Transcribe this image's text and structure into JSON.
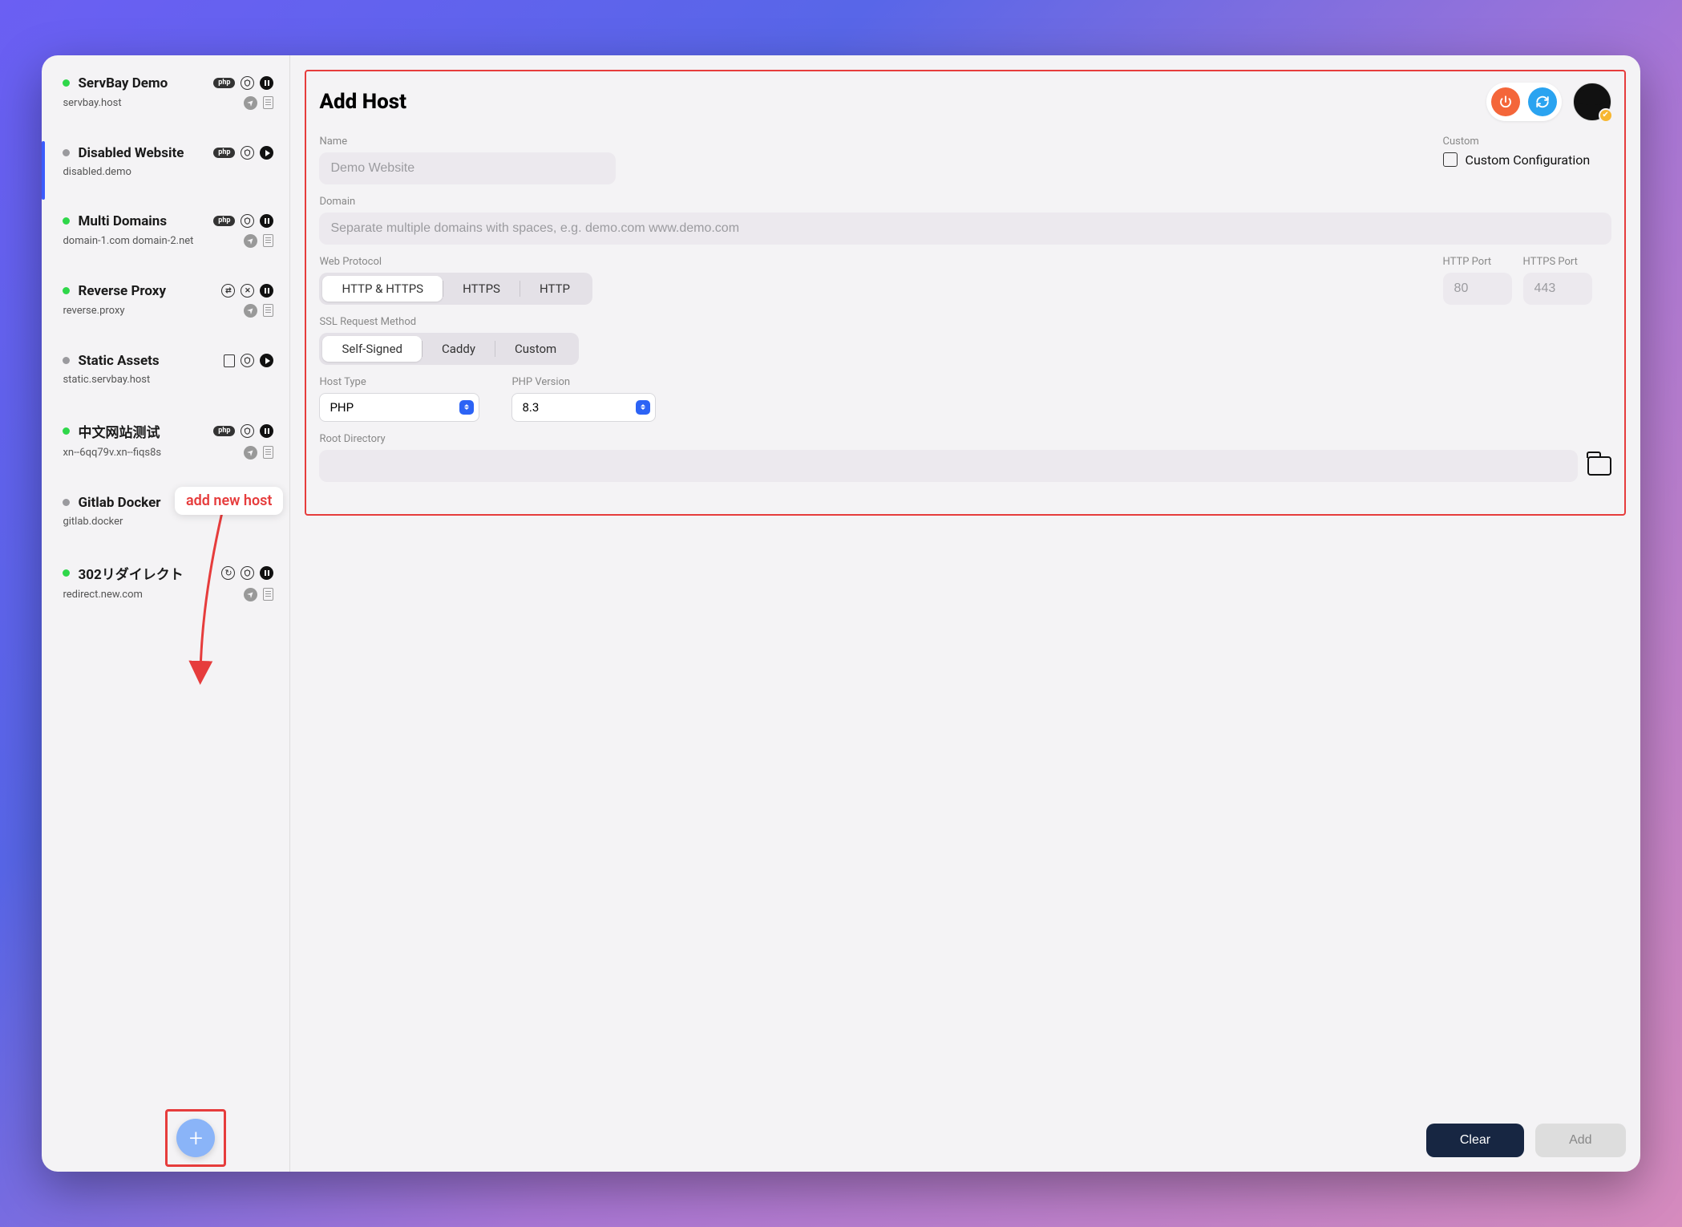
{
  "sidebar": {
    "hosts": [
      {
        "name": "ServBay Demo",
        "domain": "servbay.host",
        "status": "green",
        "tag": "php",
        "icons": [
          "shield",
          "pause"
        ],
        "sub_icons": [
          "compass",
          "doc"
        ]
      },
      {
        "name": "Disabled Website",
        "domain": "disabled.demo",
        "status": "gray",
        "tag": "php",
        "icons": [
          "shield",
          "play"
        ],
        "sub_icons": [],
        "selected": true
      },
      {
        "name": "Multi Domains",
        "domain": "domain-1.com domain-2.net",
        "status": "green",
        "tag": "php",
        "icons": [
          "shield",
          "pause"
        ],
        "sub_icons": [
          "compass",
          "doc"
        ]
      },
      {
        "name": "Reverse Proxy",
        "domain": "reverse.proxy",
        "status": "green",
        "tag": "swap",
        "icons": [
          "shieldx",
          "pause"
        ],
        "sub_icons": [
          "compass",
          "doc"
        ]
      },
      {
        "name": "Static Assets",
        "domain": "static.servbay.host",
        "status": "gray",
        "tag": "dev",
        "icons": [
          "shield",
          "play"
        ],
        "sub_icons": []
      },
      {
        "name": "中文网站测试",
        "domain": "xn--6qq79v.xn--fiqs8s",
        "status": "green",
        "tag": "php",
        "icons": [
          "shield",
          "pause"
        ],
        "sub_icons": [
          "compass",
          "doc"
        ]
      },
      {
        "name": "Gitlab Docker",
        "domain": "gitlab.docker",
        "status": "gray",
        "tag": "swap",
        "icons": [
          "shield",
          "play"
        ],
        "sub_icons": []
      },
      {
        "name": "302リダイレクト",
        "domain": "redirect.new.com",
        "status": "green",
        "tag": "redo",
        "icons": [
          "shield",
          "pause"
        ],
        "sub_icons": [
          "compass",
          "doc"
        ]
      }
    ],
    "tooltip": "add new host"
  },
  "main": {
    "title": "Add Host",
    "labels": {
      "name": "Name",
      "domain": "Domain",
      "web_protocol": "Web Protocol",
      "http_port": "HTTP Port",
      "https_port": "HTTPS Port",
      "ssl": "SSL Request Method",
      "host_type": "Host Type",
      "php_version": "PHP Version",
      "root": "Root Directory",
      "custom": "Custom",
      "custom_conf": "Custom Configuration"
    },
    "placeholders": {
      "name": "Demo Website",
      "domain": "Separate multiple domains with spaces, e.g. demo.com www.demo.com",
      "http_port": "80",
      "https_port": "443"
    },
    "protocol_options": [
      "HTTP & HTTPS",
      "HTTPS",
      "HTTP"
    ],
    "protocol_selected": 0,
    "ssl_options": [
      "Self-Signed",
      "Caddy",
      "Custom"
    ],
    "ssl_selected": 0,
    "host_type_value": "PHP",
    "php_version_value": "8.3",
    "buttons": {
      "clear": "Clear",
      "add": "Add"
    }
  }
}
